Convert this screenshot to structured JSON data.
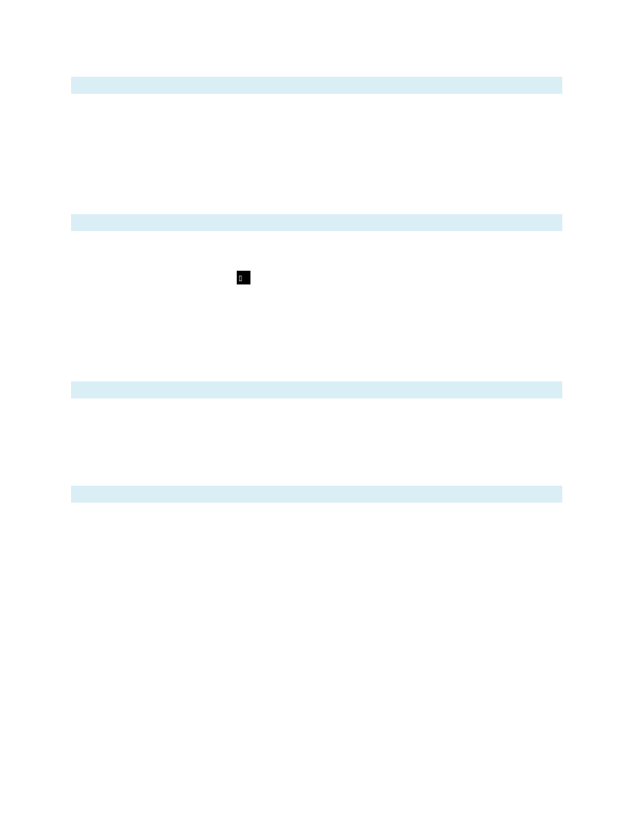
{
  "colors": {
    "page_background": "#ffffff",
    "section_band": "#daeef6",
    "glyph_box_background": "#000000",
    "glyph_color": "#ffffff"
  },
  "glyph_box": {
    "glyph": "▯",
    "icon_name": "missing-glyph-icon"
  }
}
